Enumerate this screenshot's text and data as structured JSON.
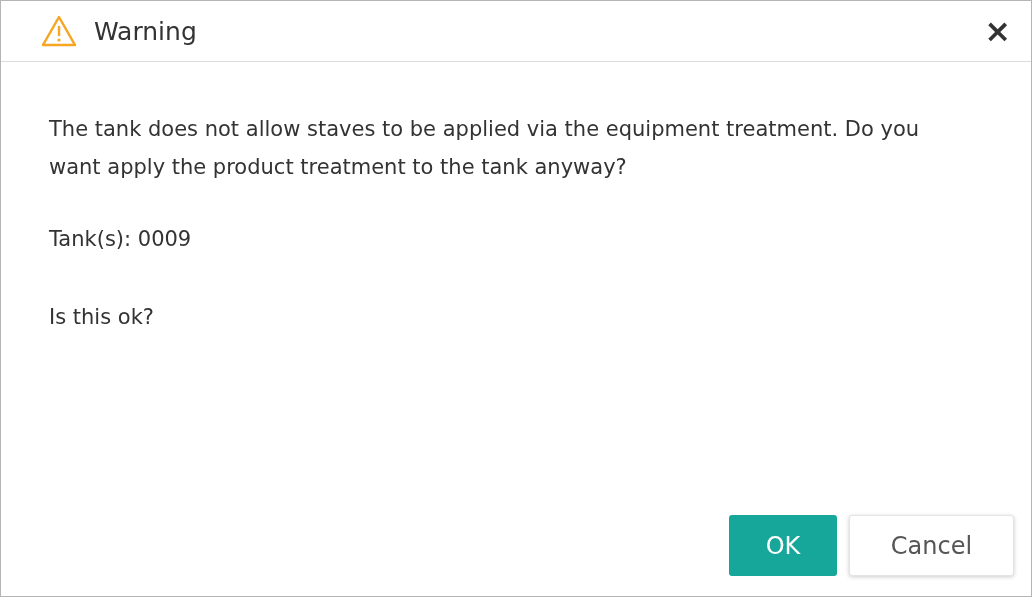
{
  "dialog": {
    "title": "Warning",
    "close": "×",
    "message": "The tank does not allow staves to be applied via the equipment treatment. Do you want apply the product treatment to the tank anyway?",
    "details": "Tank(s): 0009",
    "question": "Is this ok?",
    "buttons": [
      {
        "label": "OK",
        "kind": "primary"
      },
      {
        "label": "Cancel",
        "kind": "secondary"
      }
    ]
  }
}
